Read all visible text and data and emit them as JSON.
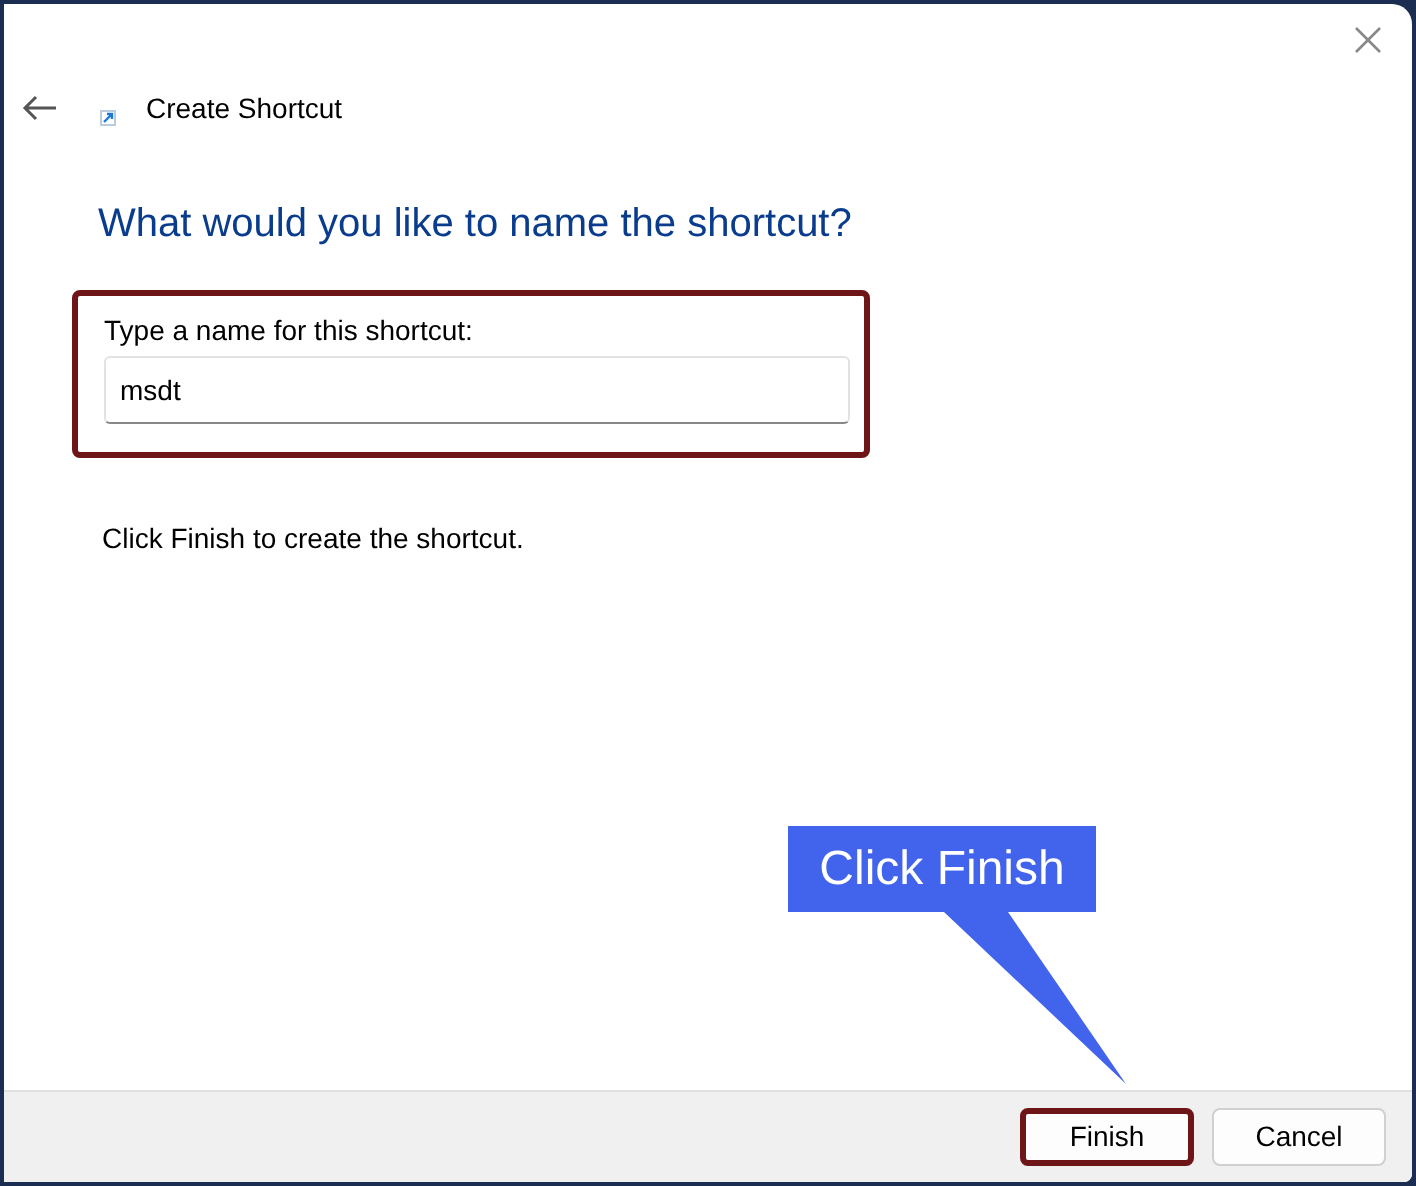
{
  "window": {
    "title": "Create Shortcut"
  },
  "heading": "What would you like to name the shortcut?",
  "name_field": {
    "label": "Type a name for this shortcut:",
    "value": "msdt",
    "highlighted": true
  },
  "instruction": "Click Finish to create the shortcut.",
  "buttons": [
    {
      "label": "Finish",
      "highlighted": true
    },
    {
      "label": "Cancel",
      "highlighted": false
    }
  ],
  "callout": {
    "text": "Click Finish"
  }
}
